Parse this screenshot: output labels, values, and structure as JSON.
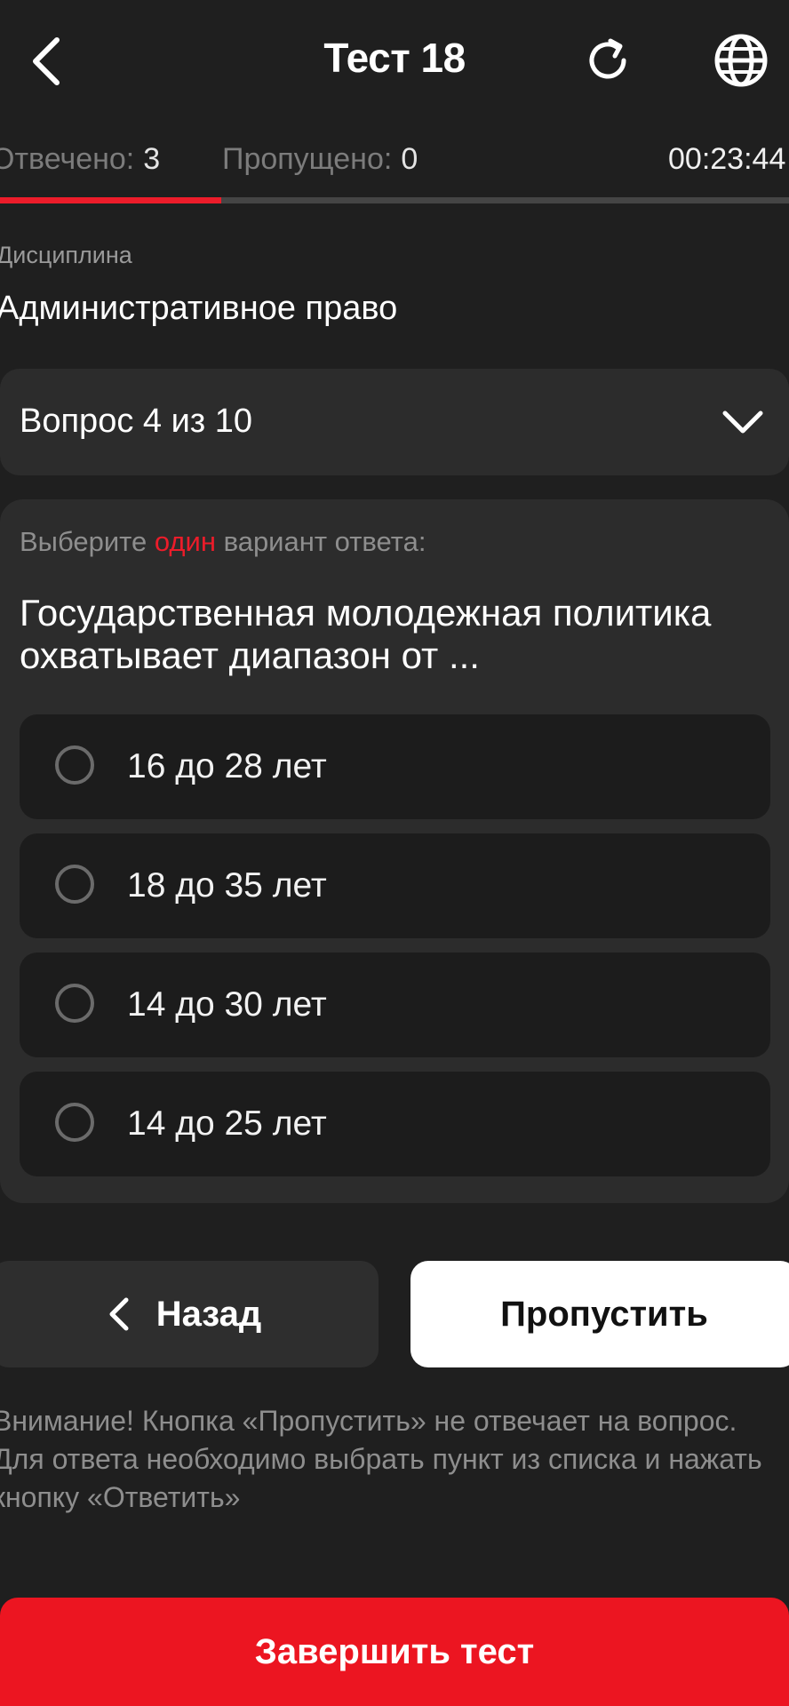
{
  "header": {
    "title": "Тест 18",
    "back_icon": "chevron-left-icon",
    "reload_icon": "reload-icon",
    "globe_icon": "globe-icon"
  },
  "stats": {
    "answered_label": "Отвечено:",
    "answered_value": "3",
    "skipped_label": "Пропущено:",
    "skipped_value": "0",
    "timer": "00:23:44",
    "progress_fraction": 0.28
  },
  "discipline": {
    "label": "Дисциплина",
    "value": "Административное право"
  },
  "question_selector": {
    "label": "Вопрос 4 из 10",
    "icon": "chevron-down-icon"
  },
  "question": {
    "instruction_before": "Выберите ",
    "instruction_accent": "один",
    "instruction_after": " вариант ответа:",
    "text": "Государственная молодежная политика охватывает диапазон от ...",
    "options": [
      {
        "label": "16 до 28 лет",
        "selected": false
      },
      {
        "label": "18 до 35 лет",
        "selected": false
      },
      {
        "label": "14 до 30 лет",
        "selected": false
      },
      {
        "label": "14 до 25 лет",
        "selected": false
      }
    ]
  },
  "buttons": {
    "back_label": "Назад",
    "skip_label": "Пропустить",
    "finish_label": "Завершить тест"
  },
  "warning": "Внимание! Кнопка «Пропустить» не отвечает на вопрос. Для ответа необходимо выбрать пункт из списка и нажать кнопку «Ответить»",
  "colors": {
    "background": "#1f1f1f",
    "card": "#2c2c2c",
    "accent": "#ec1c2a",
    "option_bg": "#1c1c1c"
  }
}
